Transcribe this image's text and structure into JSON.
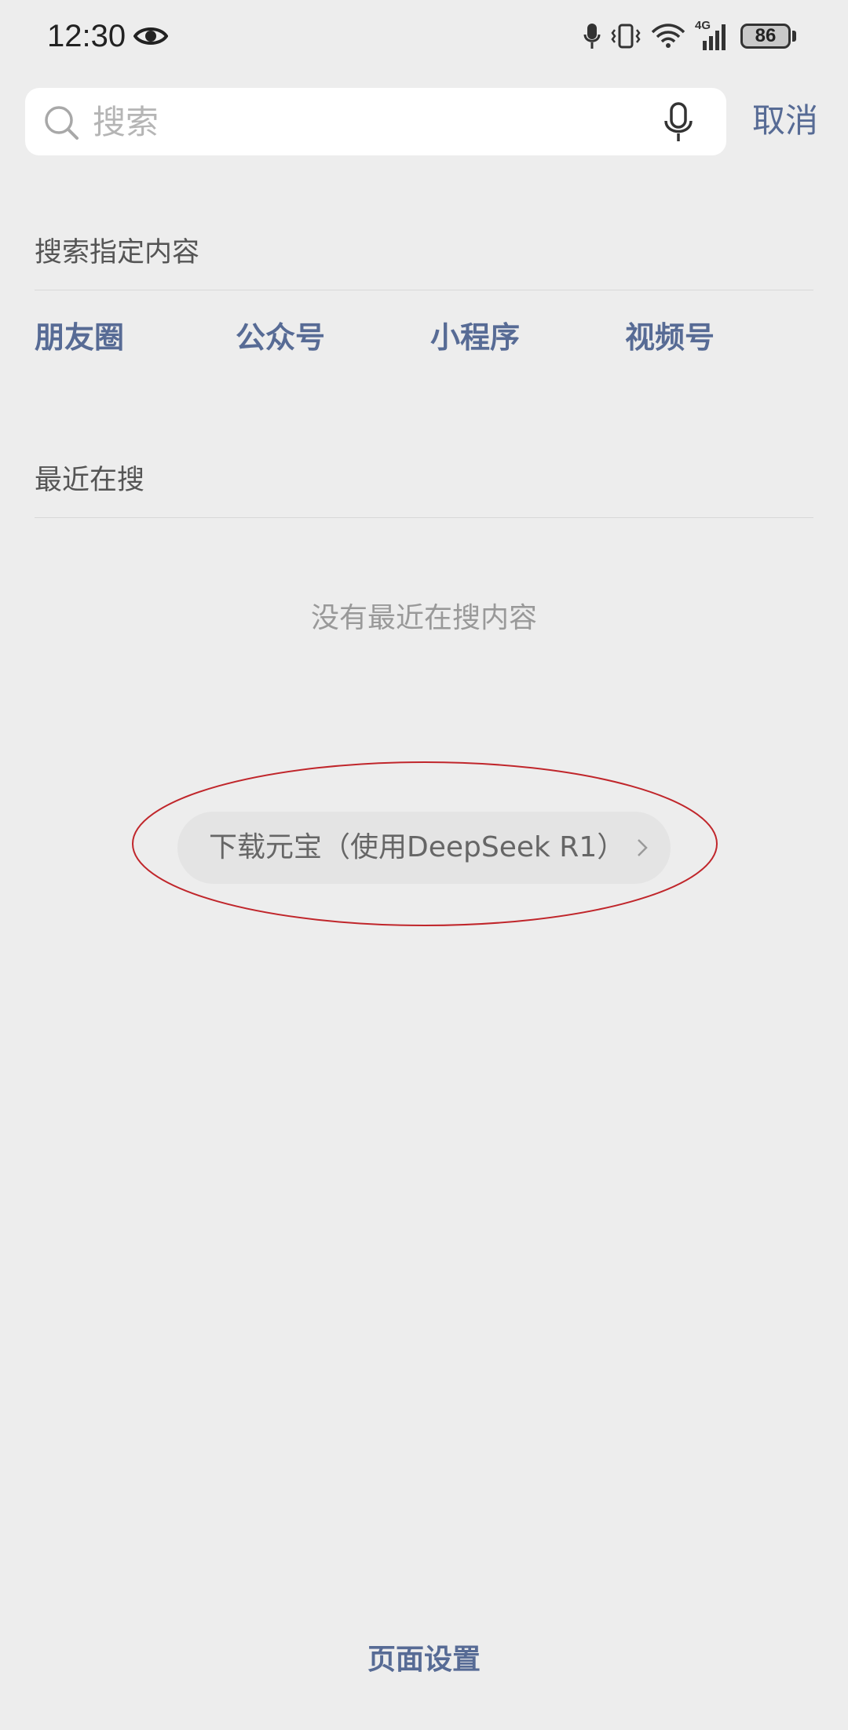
{
  "status_bar": {
    "time": "12:30",
    "battery": "86",
    "network": "4G"
  },
  "search": {
    "placeholder": "搜索",
    "value": "",
    "cancel_label": "取消"
  },
  "search_specific": {
    "title": "搜索指定内容",
    "categories": [
      {
        "label": "朋友圈"
      },
      {
        "label": "公众号"
      },
      {
        "label": "小程序"
      },
      {
        "label": "视频号"
      }
    ]
  },
  "recent": {
    "title": "最近在搜",
    "empty_text": "没有最近在搜内容"
  },
  "promo": {
    "label": "下载元宝（使用DeepSeek R1）"
  },
  "footer": {
    "page_settings_label": "页面设置"
  },
  "colors": {
    "background": "#ededed",
    "link": "#576b95",
    "annotation": "#c0262b"
  }
}
